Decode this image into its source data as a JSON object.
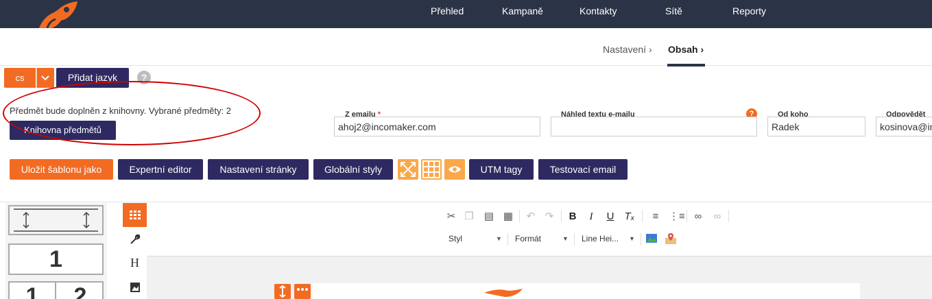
{
  "nav": {
    "items": [
      "Přehled",
      "Kampaně",
      "Kontakty",
      "Sítě",
      "Reporty"
    ]
  },
  "breadcrumb": {
    "settings": "Nastavení",
    "content": "Obsah"
  },
  "language": {
    "current": "cs",
    "add_label": "Přidat jazyk"
  },
  "subject": {
    "info": "Předmět bude doplněn z knihovny. Vybrané předměty: 2",
    "library_button": "Knihovna předmětů"
  },
  "fields": {
    "from_email_label": "Z emailu",
    "from_email_required": "*",
    "from_email_value": "ahoj2@incomaker.com",
    "preview_label": "Náhled textu e-mailu",
    "preview_value": "",
    "sender_label": "Od koho",
    "sender_value": "Radek",
    "reply_label": "Odpovědět m",
    "reply_value": "kosinova@in"
  },
  "toolbar": {
    "save_template": "Uložit šablonu jako",
    "expert_editor": "Expertní editor",
    "page_settings": "Nastavení stránky",
    "global_styles": "Globální styly",
    "utm_tags": "UTM tagy",
    "test_email": "Testovací email"
  },
  "editor": {
    "style_combo": "Styl",
    "format_combo": "Formát",
    "line_height_combo": "Line Hei...",
    "heading_tab": "H",
    "block_one_label": "1",
    "block_two_left": "1",
    "block_two_right": "2"
  },
  "colors": {
    "navbar": "#2b3447",
    "accent_orange": "#f26b22",
    "primary_navy": "#2e2a61",
    "icon_button": "#f9a94b",
    "annotation_red": "#d40000"
  }
}
